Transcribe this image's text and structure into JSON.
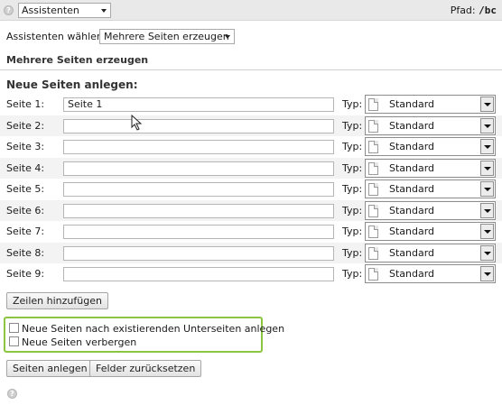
{
  "topbar": {
    "wizard_dropdown": "Assistenten",
    "path_label": "Pfad:",
    "path_value": "/bc"
  },
  "wizard": {
    "label": "Assistenten wählen:",
    "selected": "Mehrere Seiten erzeugen"
  },
  "section_title": "Mehrere Seiten erzeugen",
  "subtitle": "Neue Seiten anlegen:",
  "type_label": "Typ:",
  "rows": [
    {
      "label": "Seite 1:",
      "value": "Seite 1",
      "type": "Standard"
    },
    {
      "label": "Seite 2:",
      "value": "",
      "type": "Standard"
    },
    {
      "label": "Seite 3:",
      "value": "",
      "type": "Standard"
    },
    {
      "label": "Seite 4:",
      "value": "",
      "type": "Standard"
    },
    {
      "label": "Seite 5:",
      "value": "",
      "type": "Standard"
    },
    {
      "label": "Seite 6:",
      "value": "",
      "type": "Standard"
    },
    {
      "label": "Seite 7:",
      "value": "",
      "type": "Standard"
    },
    {
      "label": "Seite 8:",
      "value": "",
      "type": "Standard"
    },
    {
      "label": "Seite 9:",
      "value": "",
      "type": "Standard"
    }
  ],
  "buttons": {
    "add_rows": "Zeilen hinzufügen",
    "create_pages": "Seiten anlegen",
    "reset_fields": "Felder zurücksetzen"
  },
  "options": {
    "after_subpages": "Neue Seiten nach existierenden Unterseiten anlegen",
    "hide_pages": "Neue Seiten verbergen"
  },
  "colors": {
    "highlight_border": "#8cc63f",
    "row_alt": "#f3f3f3",
    "topbar_bg": "#e9e9e9"
  }
}
